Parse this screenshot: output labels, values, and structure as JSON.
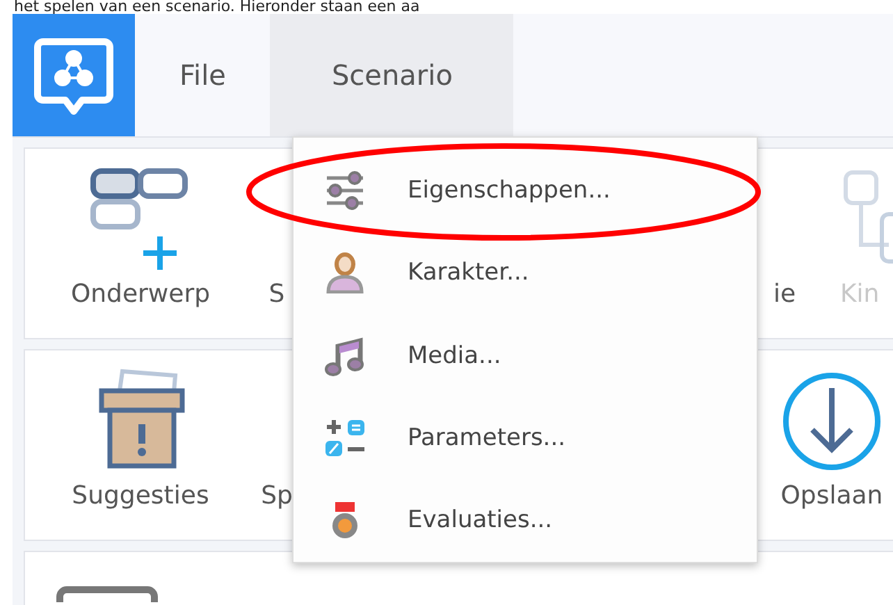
{
  "caption": "het spelen van een scenario. Hieronder staan een aa",
  "menubar": [
    {
      "label": "File",
      "selected": false
    },
    {
      "label": "Scenario",
      "selected": true
    }
  ],
  "toolbar_rows": [
    [
      {
        "kind": "topic",
        "label": "Onderwerp",
        "disabled": false
      },
      {
        "kind": "partial",
        "label": "S",
        "disabled": false
      },
      {
        "kind": "partial-right",
        "label": "ie",
        "disabled": false
      },
      {
        "kind": "child",
        "label": "Kin",
        "disabled": true
      }
    ],
    [
      {
        "kind": "suggestions",
        "label": "Suggesties",
        "disabled": false
      },
      {
        "kind": "partial",
        "label": "Sp",
        "disabled": false
      },
      {
        "kind": "save",
        "label": "Opslaan",
        "disabled": false
      }
    ]
  ],
  "dropdown": [
    {
      "kind": "sliders",
      "label": "Eigenschappen..."
    },
    {
      "kind": "person",
      "label": "Karakter..."
    },
    {
      "kind": "music",
      "label": "Media..."
    },
    {
      "kind": "calc",
      "label": "Parameters..."
    },
    {
      "kind": "medal",
      "label": "Evaluaties..."
    }
  ],
  "annotation": {
    "kind": "ellipse"
  }
}
